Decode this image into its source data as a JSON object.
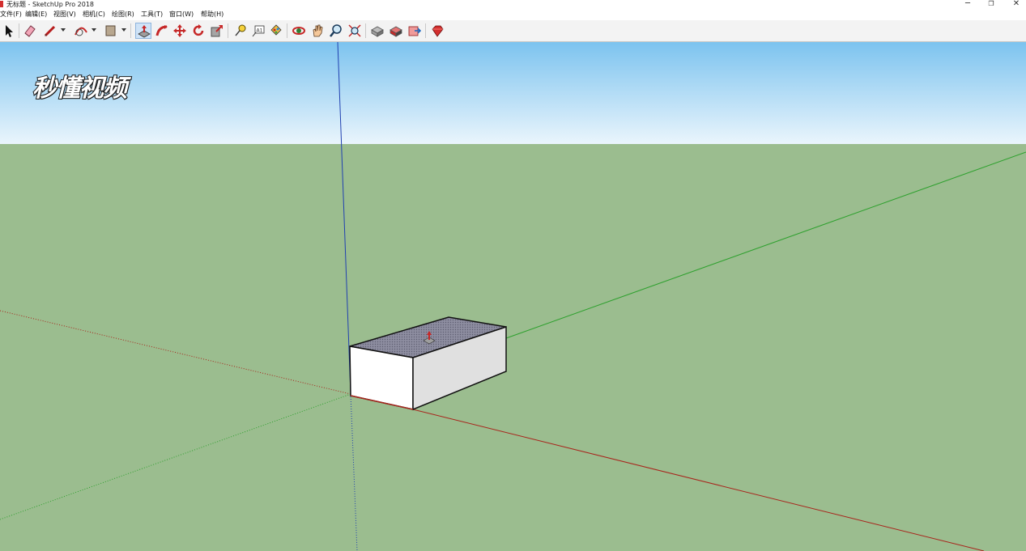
{
  "window": {
    "title": "无标题 - SketchUp Pro 2018",
    "controls": {
      "minimize": "─",
      "restore": "❐",
      "close": "✕"
    }
  },
  "menu": [
    {
      "label": "文件(F)"
    },
    {
      "label": "编辑(E)"
    },
    {
      "label": "视图(V)"
    },
    {
      "label": "相机(C)"
    },
    {
      "label": "绘图(R)"
    },
    {
      "label": "工具(T)"
    },
    {
      "label": "窗口(W)"
    },
    {
      "label": "帮助(H)"
    }
  ],
  "toolbar": {
    "tools": [
      {
        "icon": "select-arrow-icon"
      },
      {
        "icon": "eraser-icon"
      },
      {
        "icon": "line-pencil-icon"
      },
      {
        "icon": "arc-icon"
      },
      {
        "icon": "rectangle-shape-icon"
      },
      {
        "icon": "push-pull-icon"
      },
      {
        "icon": "follow-me-icon"
      },
      {
        "icon": "move-icon"
      },
      {
        "icon": "rotate-icon"
      },
      {
        "icon": "scale-icon"
      },
      {
        "icon": "tape-measure-icon"
      },
      {
        "icon": "text-label-icon"
      },
      {
        "icon": "paint-bucket-icon"
      },
      {
        "icon": "orbit-icon"
      },
      {
        "icon": "pan-hand-icon"
      },
      {
        "icon": "zoom-icon"
      },
      {
        "icon": "zoom-extents-icon"
      },
      {
        "icon": "3d-warehouse-icon"
      },
      {
        "icon": "extension-warehouse-icon"
      },
      {
        "icon": "layout-send-icon"
      },
      {
        "icon": "ruby-extension-icon"
      }
    ],
    "active_tool": "push-pull-icon"
  },
  "viewport": {
    "sky_top_color": "#7cc3ef",
    "sky_bottom_color": "#eaf5fc",
    "ground_color": "#9bbd8f",
    "axis_colors": {
      "red": "#a8251c",
      "green": "#2fa12f",
      "blue": "#2040b0"
    }
  },
  "watermark": {
    "text": "秒懂视频"
  }
}
